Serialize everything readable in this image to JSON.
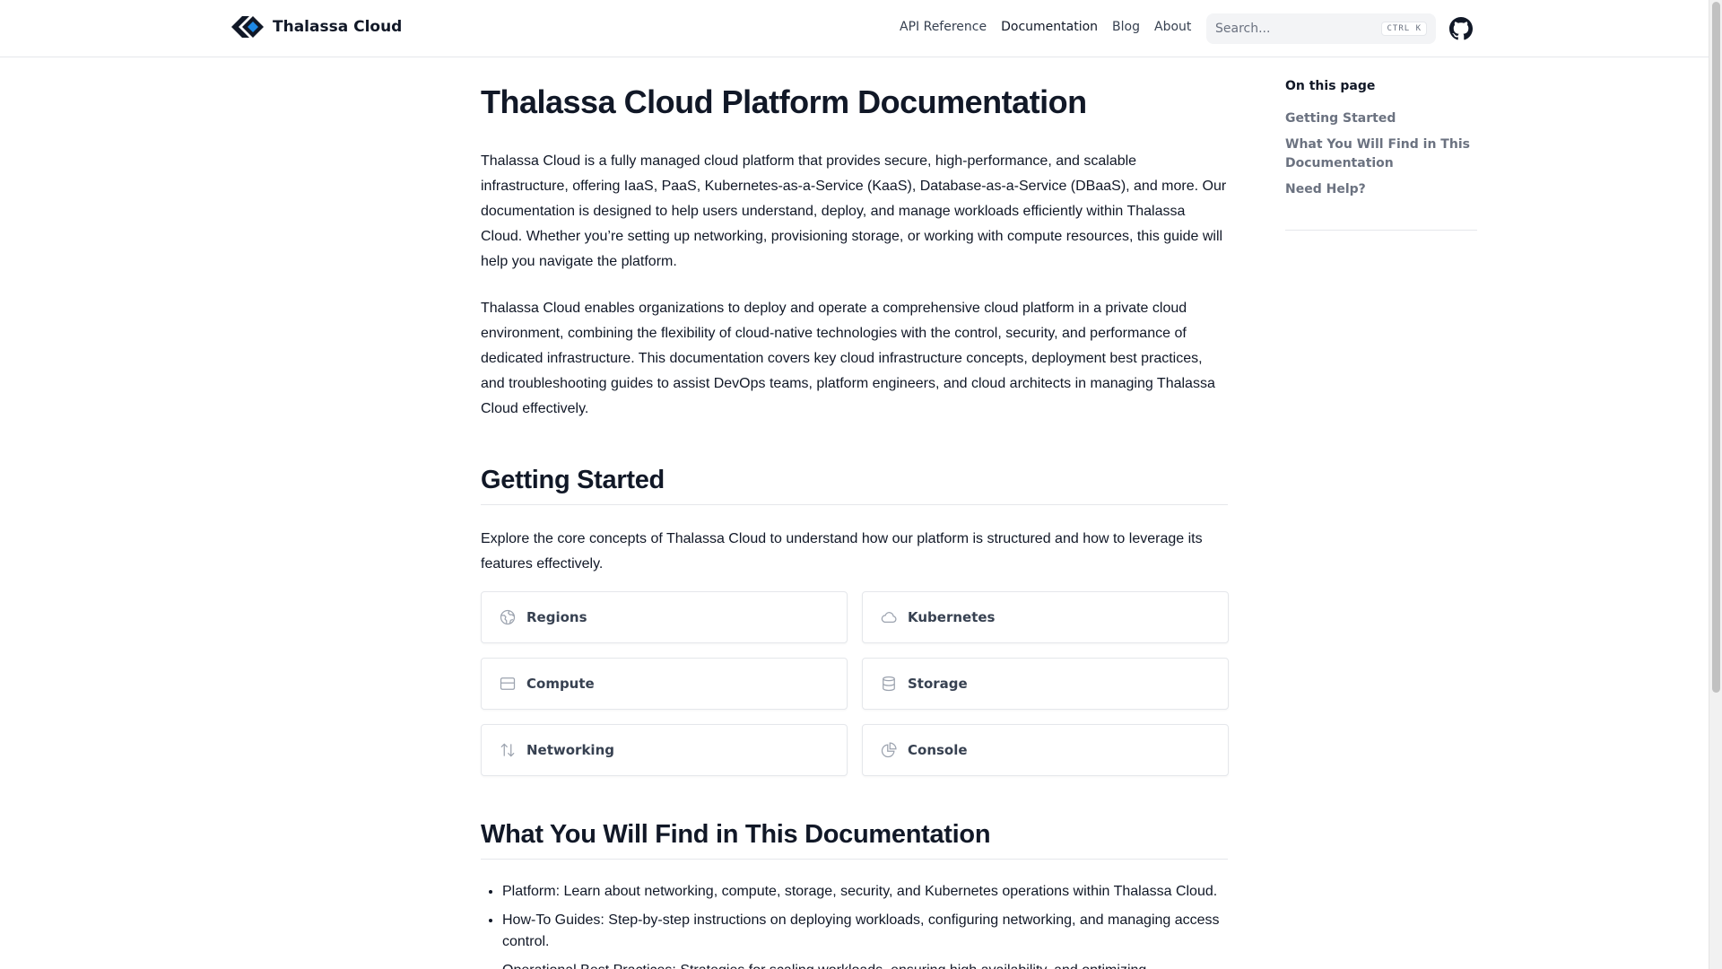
{
  "header": {
    "brand": "Thalassa Cloud",
    "nav": [
      "API Reference",
      "Documentation",
      "Blog",
      "About"
    ],
    "search_placeholder": "Search...",
    "search_shortcut": "CTRL K"
  },
  "main": {
    "title": "Thalassa Cloud Platform Documentation",
    "intro_1": "Thalassa Cloud is a fully managed cloud platform that provides secure, high-performance, and scalable infrastructure, offering IaaS, PaaS, Kubernetes-as-a-Service (KaaS), Database-as-a-Service (DBaaS), and more. Our documentation is designed to help users understand, deploy, and manage workloads efficiently within Thalassa Cloud. Whether you’re setting up networking, provisioning storage, or working with compute resources, this guide will help you navigate the platform.",
    "intro_2": "Thalassa Cloud enables organizations to deploy and operate a comprehensive cloud platform in a private cloud environment, combining the flexibility of cloud-native technologies with the control, security, and performance of dedicated infrastructure. This documentation covers key cloud infrastructure concepts, deployment best practices, and troubleshooting guides to assist DevOps teams, platform engineers, and cloud architects in managing Thalassa Cloud effectively.",
    "getting_started": {
      "heading": "Getting Started",
      "text": "Explore the core concepts of Thalassa Cloud to understand how our platform is structured and how to leverage its features effectively.",
      "cards": [
        {
          "label": "Regions",
          "icon": "globe-icon"
        },
        {
          "label": "Kubernetes",
          "icon": "cloud-icon"
        },
        {
          "label": "Compute",
          "icon": "server-icon"
        },
        {
          "label": "Storage",
          "icon": "database-icon"
        },
        {
          "label": "Networking",
          "icon": "arrows-up-down-icon"
        },
        {
          "label": "Console",
          "icon": "chart-pie-icon"
        }
      ]
    },
    "find": {
      "heading": "What You Will Find in This Documentation",
      "items": [
        "Platform: Learn about networking, compute, storage, security, and Kubernetes operations within Thalassa Cloud.",
        "How-To Guides: Step-by-step instructions on deploying workloads, configuring networking, and managing access control.",
        "Operational Best Practices: Strategies for scaling workloads, ensuring high availability, and optimizing"
      ]
    }
  },
  "toc": {
    "title": "On this page",
    "items": [
      "Getting Started",
      "What You Will Find in This Documentation",
      "Need Help?"
    ]
  }
}
